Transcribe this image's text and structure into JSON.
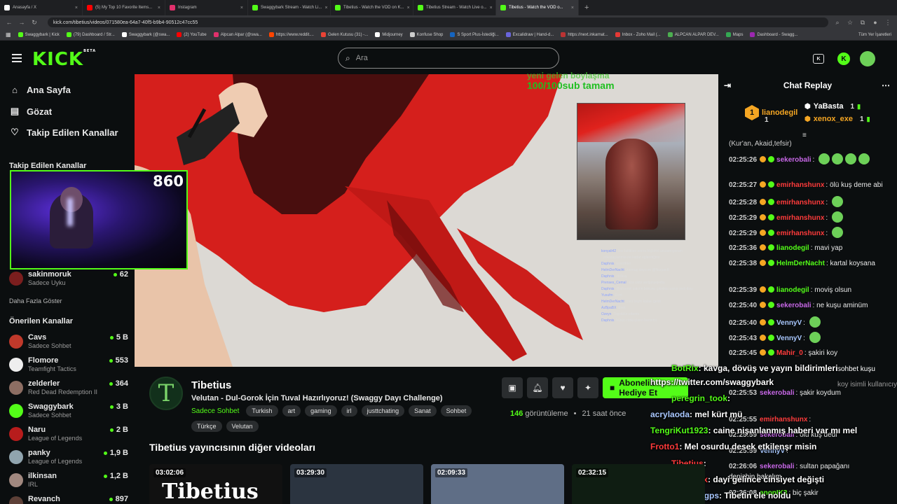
{
  "browser": {
    "tabs": [
      {
        "label": "Anasayfa / X",
        "color": "#ffffff"
      },
      {
        "label": "(5) My Top 10 Favorite Items...",
        "color": "#ff0000"
      },
      {
        "label": "Instagram",
        "color": "#e1306c"
      },
      {
        "label": "Swaggybark Stream - Watch Li...",
        "color": "#53fc18"
      },
      {
        "label": "Tibetius - Watch the VOD on K...",
        "color": "#53fc18"
      },
      {
        "label": "Tibetius Stream - Watch Live o...",
        "color": "#53fc18"
      },
      {
        "label": "Tibetius - Watch the VOD o...",
        "color": "#53fc18"
      }
    ],
    "url": "kick.com/tibetius/videos/071580ea-64a7-40f5-b9b4-90512c47cc55",
    "bookmarks": [
      {
        "label": "Swaggybark | Kick",
        "color": "#53fc18"
      },
      {
        "label": "(79) Dashboard / Str...",
        "color": "#53fc18"
      },
      {
        "label": "Swaggybark (@swa...",
        "color": "#ffffff"
      },
      {
        "label": "(2) YouTube",
        "color": "#ff0000"
      },
      {
        "label": "Alpcan Alpar (@swa...",
        "color": "#e1306c"
      },
      {
        "label": "https://www.reddit....",
        "color": "#ff4500"
      },
      {
        "label": "Gelen Kutusu (31) -...",
        "color": "#ea4335"
      },
      {
        "label": "Midjourney",
        "color": "#ffffff"
      },
      {
        "label": "Konfuse Shop",
        "color": "#cccccc"
      },
      {
        "label": "S Sport Plus-İstediği...",
        "color": "#1565c0"
      },
      {
        "label": "Excalidraw | Hand-d...",
        "color": "#6965db"
      },
      {
        "label": "https://next.inkarnat...",
        "color": "#b33"
      },
      {
        "label": "Inbox - Zoho Mail (...",
        "color": "#e53935"
      },
      {
        "label": "ALPCAN ALPAR DEV...",
        "color": "#4caf50"
      },
      {
        "label": "Maps",
        "color": "#34a853"
      },
      {
        "label": "Dashboard - Swagg...",
        "color": "#9c27b0"
      }
    ],
    "all_bookmarks": "Tüm Yer İşaretleri"
  },
  "header": {
    "logo": "KICK",
    "logo_badge": "BETA",
    "search_placeholder": "Ara"
  },
  "sidebar": {
    "nav": [
      {
        "label": "Ana Sayfa",
        "icon": "home-icon"
      },
      {
        "label": "Gözat",
        "icon": "browse-icon"
      },
      {
        "label": "Takip Edilen Kanallar",
        "icon": "heart-icon"
      }
    ],
    "followed_heading": "Takip Edilen Kanallar",
    "followed": [
      {
        "name": "sakinmoruk",
        "category": "Sadece Uyku",
        "viewers": "62",
        "color": "#7b1e1e"
      }
    ],
    "more": "Daha Fazla Göster",
    "recommended_heading": "Önerilen Kanallar",
    "recommended": [
      {
        "name": "Cavs",
        "category": "Sadece Sohbet",
        "viewers": "5 B",
        "color": "#c0392b"
      },
      {
        "name": "Flomore",
        "category": "Teamfight Tactics",
        "viewers": "553",
        "color": "#eeeeee"
      },
      {
        "name": "zelderler",
        "category": "Red Dead Redemption II",
        "viewers": "364",
        "color": "#8d6e63"
      },
      {
        "name": "Swaggybark",
        "category": "Sadece Sohbet",
        "viewers": "3 B",
        "color": "#53fc18"
      },
      {
        "name": "Naru",
        "category": "League of Legends",
        "viewers": "2 B",
        "color": "#b71c1c"
      },
      {
        "name": "panky",
        "category": "League of Legends",
        "viewers": "1,9 B",
        "color": "#90a4ae"
      },
      {
        "name": "ilkinsan",
        "category": "IRL",
        "viewers": "1,2 B",
        "color": "#a1887f"
      },
      {
        "name": "Revanch",
        "category": "",
        "viewers": "897",
        "color": "#5d4037"
      }
    ],
    "webcam_count": "860"
  },
  "video": {
    "overlay_line1": "yeni gelen boylaşma",
    "overlay_line2": "100/100sub tamam",
    "chat_overlay": [
      {
        "user": "konyali42",
        "msg": "lise bittikten sonra hiçbirini unutamıyorum"
      },
      {
        "user": "",
        "msg": "arkadaşlarımla ne kadar eğlendiğimi"
      },
      {
        "user": "Daphnis",
        "msg": "esenlikler"
      },
      {
        "user": "HelmDerNacht",
        "msg": "zormuş dayıcım @NurpacB"
      },
      {
        "user": "Daphnis",
        "msg": "cicikuş"
      },
      {
        "user": "Prenses_Cemal",
        "msg": "aka siktir aodjahsejodia"
      },
      {
        "user": "Daphnis",
        "msg": "@alisenel sakırin bokunu çıkolata sanıp yedi dayı"
      },
      {
        "user": "Yusufm",
        "msg": "Evet"
      },
      {
        "user": "HelmDerNacht",
        "msg": "coni beyin kolası geldi"
      },
      {
        "user": "AzBpaBX",
        "msg": "Evet"
      },
      {
        "user": "Ozeyn",
        "msg": "Teşekkür ederim"
      },
      {
        "user": "Daphnis",
        "msg": "bütün cicikuşların becerini"
      }
    ]
  },
  "channel": {
    "logo": "T",
    "name": "Tibetius",
    "title": "Velutan - Dul-Gorok İçin Tuval Hazırlıyoruz! (Swaggy Dayı Challenge)",
    "category": "Sadece Sohbet",
    "tags": [
      "Turkish",
      "art",
      "gaming",
      "irl",
      "justtchating",
      "Sanat",
      "Sohbet"
    ],
    "tags2": [
      "Türkçe",
      "Velutan"
    ],
    "gift_label": "Abonelik Hediye Et",
    "views": "146",
    "views_label": "görüntüleme",
    "ago": "21 saat önce"
  },
  "other_videos": {
    "heading": "Tibetius yayıncısının diğer videoları",
    "items": [
      {
        "duration": "03:02:06",
        "caption": "Tibetius",
        "color": "#111111"
      },
      {
        "duration": "03:29:30",
        "caption": "",
        "color": "#2b3440"
      },
      {
        "duration": "02:09:33",
        "caption": "",
        "color": "#5f6e86"
      },
      {
        "duration": "02:32:15",
        "caption": "",
        "color": "#0f1d12"
      }
    ]
  },
  "chat": {
    "title": "Chat Replay",
    "top_gifters": [
      {
        "name": "lianodegil",
        "count": "1",
        "rank": "1",
        "color": "#f5a623"
      },
      {
        "name": "YaBasta",
        "count": "1",
        "color": "#ffffff"
      },
      {
        "name": "xenox_exe",
        "count": "1",
        "color": "#f5a623"
      }
    ],
    "truncated": "(Kur'an, Akaid,tefsir)",
    "messages": [
      {
        "time": "02:25:26",
        "user": "sekerobali",
        "color": "#c767e6",
        "text": "",
        "emotes": 4
      },
      {
        "time": "02:25:27",
        "user": "emirhanshunx",
        "color": "#ff3b3b",
        "text": "ölü kuş deme abi",
        "emotes": 0
      },
      {
        "time": "02:25:28",
        "user": "emirhanshunx",
        "color": "#ff3b3b",
        "text": "",
        "emotes": 1
      },
      {
        "time": "02:25:29",
        "user": "emirhanshunx",
        "color": "#ff3b3b",
        "text": "",
        "emotes": 1
      },
      {
        "time": "02:25:29",
        "user": "emirhanshunx",
        "color": "#ff3b3b",
        "text": "",
        "emotes": 1
      },
      {
        "time": "02:25:36",
        "user": "lianodegil",
        "color": "#53fc18",
        "text": "mavi yap",
        "emotes": 0
      },
      {
        "time": "02:25:38",
        "user": "HelmDerNacht",
        "color": "#53fc18",
        "text": "kartal koysana",
        "emotes": 0
      },
      {
        "time": "02:25:39",
        "user": "lianodegil",
        "color": "#53fc18",
        "text": "moviş olsun",
        "emotes": 0
      },
      {
        "time": "02:25:40",
        "user": "sekerobali",
        "color": "#c767e6",
        "text": "ne kuşu aminüm",
        "emotes": 0
      },
      {
        "time": "02:25:40",
        "user": "VennyV",
        "color": "#a9c8ff",
        "text": "",
        "emotes": 1
      },
      {
        "time": "02:25:43",
        "user": "VennyV",
        "color": "#a9c8ff",
        "text": "",
        "emotes": 1
      },
      {
        "time": "02:25:45",
        "user": "Mahir_0",
        "color": "#ff3b3b",
        "text": "şakiri koy",
        "emotes": 0
      }
    ],
    "replies": [
      {
        "time": "",
        "user": "",
        "color": "#ffffff",
        "text": "sohbet kuşu"
      },
      {
        "time": "",
        "user": "",
        "color": "#9a9a9a",
        "text": "koy isimli kullanıcıya yanıt veri..."
      },
      {
        "time": "02:25:53",
        "user": "sekerobali",
        "color": "#c767e6",
        "text": "şakir koydum"
      },
      {
        "time": "02:25:55",
        "user": "emirhanshunx",
        "color": "#ff3b3b",
        "text": ""
      },
      {
        "time": "02:25:59",
        "user": "sekerobali",
        "color": "#c767e6",
        "text": "ölü kuş dedi"
      },
      {
        "time": "02:25:59",
        "user": "VennyV",
        "color": "#a9c8ff",
        "text": ""
      },
      {
        "time": "02:26:06",
        "user": "sekerobali",
        "color": "#c767e6",
        "text": "sultan papağanı"
      },
      {
        "time": "",
        "user": "",
        "color": "#ffffff",
        "text": "denizbin bakalım"
      },
      {
        "time": "02:26:08",
        "user": "anonIK3",
        "color": "#53fc18",
        "text": "biç şakir"
      }
    ]
  },
  "stream_overlay_chat": [
    {
      "user": "BotRix",
      "color": "#53fc18",
      "text": ": kavga, dövüş ve yayın bildirimleri"
    },
    {
      "user": "",
      "color": "#ffffff",
      "text": "https://twitter.com/swaggybark"
    },
    {
      "user": "peregrin_took",
      "color": "#53fc18",
      "text": ":"
    },
    {
      "user": "acrylaoda",
      "color": "#a9c8ff",
      "text": ": mel kürt mü"
    },
    {
      "user": "TengriKut1923",
      "color": "#53fc18",
      "text": ": caine nişanlanmış haberi var mı mel"
    },
    {
      "user": "Frotto1",
      "color": "#ff3b3b",
      "text": ": Mel osurdu desek etkilenşr misin"
    },
    {
      "user": "Tibetius",
      "color": "#ff3b3b",
      "text": ":"
    },
    {
      "user": "emirhanshunx",
      "color": "#ff3b3b",
      "text": ": dayi gelince cinsiyet değişti"
    },
    {
      "user": "huseyinpskingps",
      "color": "#a9c8ff",
      "text": ": Tibetin ele noldu"
    }
  ]
}
